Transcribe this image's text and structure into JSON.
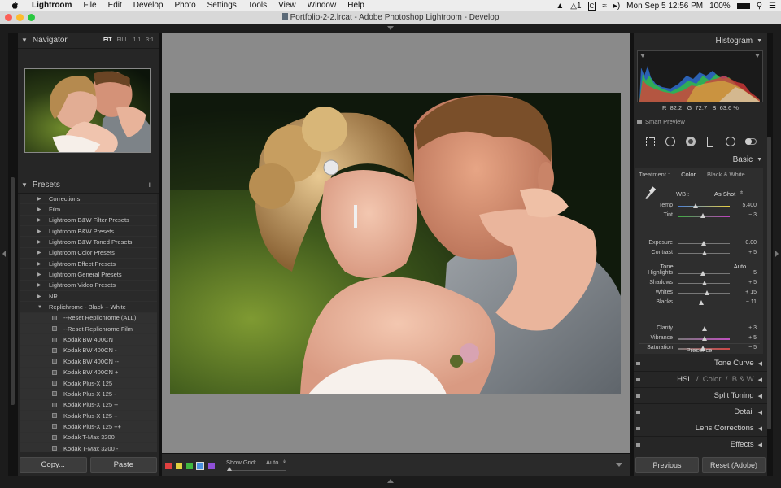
{
  "menubar": {
    "items": [
      "Lightroom",
      "File",
      "Edit",
      "Develop",
      "Photo",
      "Settings",
      "Tools",
      "View",
      "Window",
      "Help"
    ],
    "status_one": "1",
    "status_c": "C",
    "datetime": "Mon Sep 5  12:56 PM",
    "battery": "100%"
  },
  "window": {
    "title": "Portfolio-2-2.lrcat - Adobe Photoshop Lightroom - Develop"
  },
  "navigator": {
    "title": "Navigator",
    "zoom_options": [
      "FIT",
      "FILL",
      "1:1",
      "3:1"
    ]
  },
  "presets": {
    "title": "Presets",
    "add": "+",
    "folders": [
      "Corrections",
      "Film",
      "Lightroom B&W Filter Presets",
      "Lightroom B&W Presets",
      "Lightroom B&W Toned Presets",
      "Lightroom Color Presets",
      "Lightroom Effect Presets",
      "Lightroom General Presets",
      "Lightroom Video Presets",
      "NR"
    ],
    "open_folder": "Replichrome - Black + White",
    "items": [
      "--Reset Replichrome (ALL)",
      "--Reset Replichrome Film",
      "Kodak BW 400CN",
      "Kodak BW 400CN -",
      "Kodak BW 400CN --",
      "Kodak BW 400CN +",
      "Kodak Plus-X 125",
      "Kodak Plus-X 125 -",
      "Kodak Plus-X 125 --",
      "Kodak Plus-X 125 +",
      "Kodak Plus-X 125 ++",
      "Kodak T-Max 3200",
      "Kodak T-Max 3200 -"
    ]
  },
  "left_buttons": {
    "copy": "Copy...",
    "paste": "Paste"
  },
  "toolbar": {
    "swatches": [
      "#e04040",
      "#e0d040",
      "#40b840",
      "#4a90e0",
      "#9050d8"
    ],
    "show_grid_label": "Show Grid:",
    "show_grid_value": "Auto"
  },
  "histogram": {
    "title": "Histogram",
    "r_label": "R",
    "r_value": "82.2",
    "g_label": "G",
    "g_value": "72.7",
    "b_label": "B",
    "b_value": "63.6",
    "pct": "%",
    "smart_preview": "Smart Preview"
  },
  "basic": {
    "title": "Basic",
    "treatment_label": "Treatment :",
    "treatment_color": "Color",
    "treatment_bw": "Black & White",
    "wb_label": "WB :",
    "wb_value": "As Shot",
    "tone_label": "Tone",
    "auto_label": "Auto",
    "presence_label": "Presence",
    "sliders": [
      {
        "label": "Temp",
        "value": "5,400",
        "pos": 0.35
      },
      {
        "label": "Tint",
        "value": "− 3",
        "pos": 0.48
      },
      {
        "label": "Exposure",
        "value": "0.00",
        "pos": 0.5
      },
      {
        "label": "Contrast",
        "value": "+ 5",
        "pos": 0.52
      },
      {
        "label": "Highlights",
        "value": "− 5",
        "pos": 0.48
      },
      {
        "label": "Shadows",
        "value": "+ 5",
        "pos": 0.52
      },
      {
        "label": "Whites",
        "value": "+ 15",
        "pos": 0.57
      },
      {
        "label": "Blacks",
        "value": "− 11",
        "pos": 0.45
      },
      {
        "label": "Clarity",
        "value": "+ 3",
        "pos": 0.51
      },
      {
        "label": "Vibrance",
        "value": "+ 5",
        "pos": 0.52
      },
      {
        "label": "Saturation",
        "value": "− 5",
        "pos": 0.48
      }
    ]
  },
  "panels": {
    "tone_curve": "Tone Curve",
    "hsl": "HSL",
    "slash": "/",
    "color": "Color",
    "bw": "B & W",
    "split_toning": "Split Toning",
    "detail": "Detail",
    "lens_corrections": "Lens Corrections",
    "effects": "Effects"
  },
  "right_buttons": {
    "previous": "Previous",
    "reset": "Reset (Adobe)"
  }
}
